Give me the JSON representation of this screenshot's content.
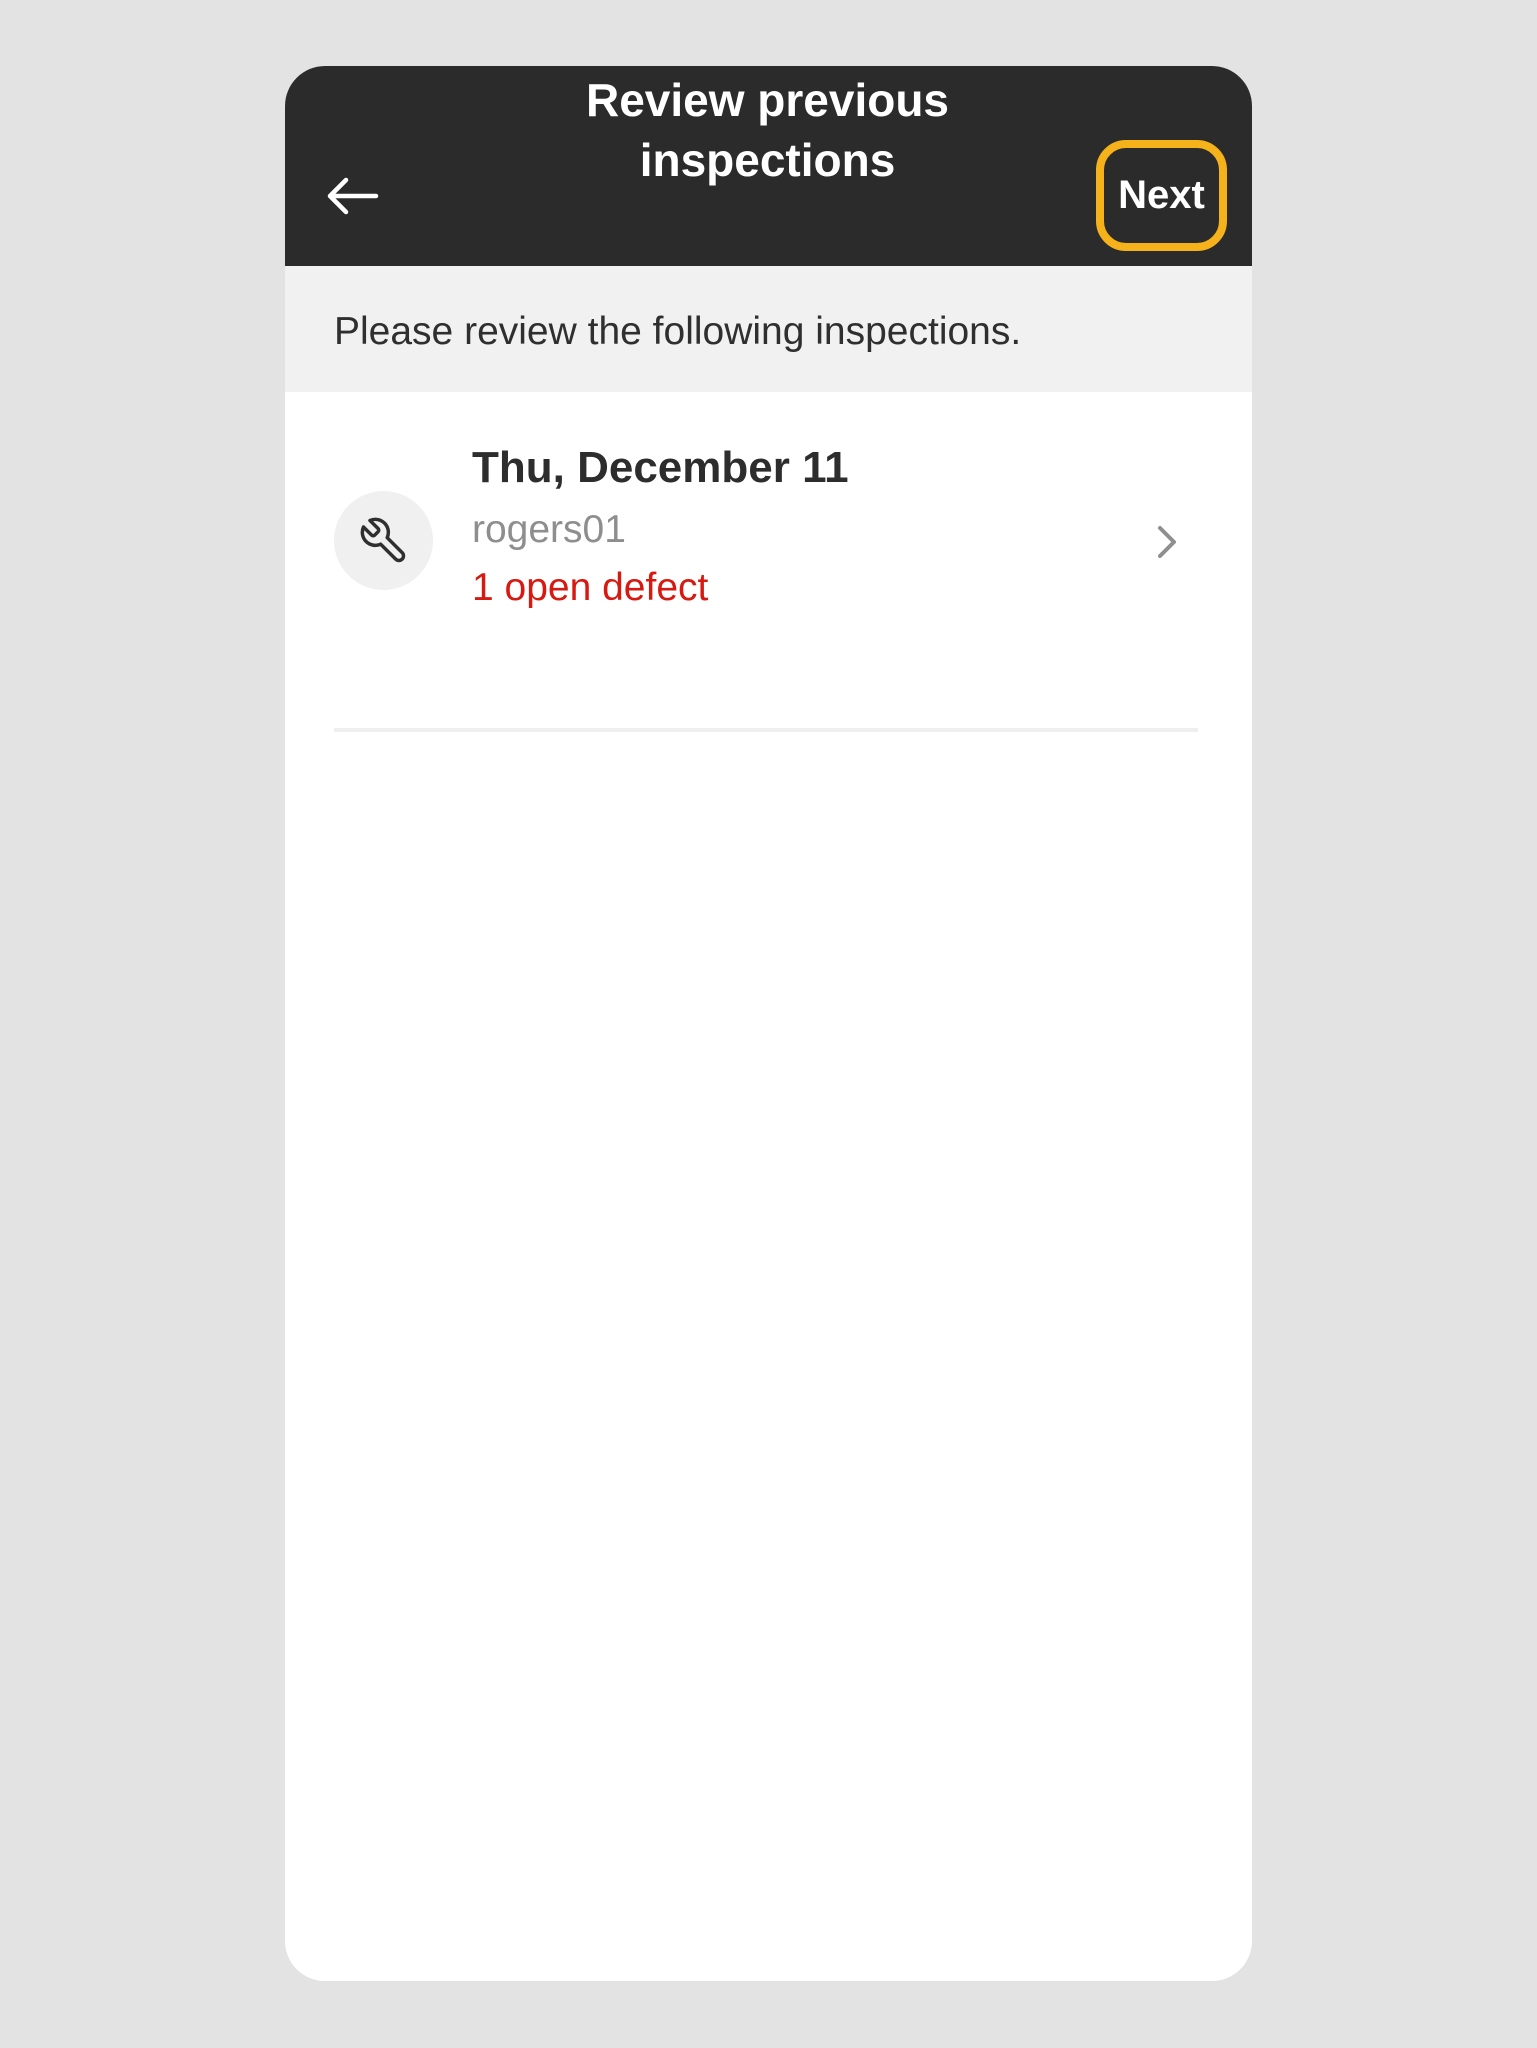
{
  "header": {
    "title": "Review previous inspections",
    "back_icon": "arrow-left-icon",
    "next_label": "Next",
    "accent_color": "#f5b21b"
  },
  "banner": {
    "text": "Please review the following inspections."
  },
  "inspections": [
    {
      "date": "Thu, December 11",
      "user": "rogers01",
      "defects": "1 open defect",
      "icon": "wrench-icon",
      "chevron_icon": "chevron-right-icon"
    }
  ],
  "colors": {
    "header_bg": "#2b2b2b",
    "defect_red": "#d61a12",
    "banner_bg": "#f1f1f1"
  }
}
